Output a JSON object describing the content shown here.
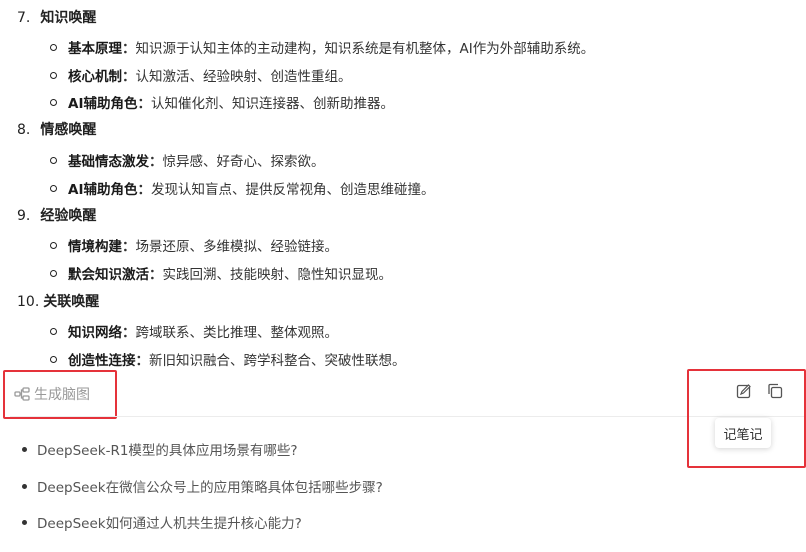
{
  "sections": [
    {
      "number": "7.",
      "title": "知识唤醒",
      "items": [
        {
          "label": "基本原理",
          "text": "知识源于认知主体的主动建构，知识系统是有机整体，AI作为外部辅助系统。"
        },
        {
          "label": "核心机制",
          "text": "认知激活、经验映射、创造性重组。"
        },
        {
          "label": "AI辅助角色",
          "text": "认知催化剂、知识连接器、创新助推器。"
        }
      ]
    },
    {
      "number": "8.",
      "title": "情感唤醒",
      "items": [
        {
          "label": "基础情态激发",
          "text": "惊异感、好奇心、探索欲。"
        },
        {
          "label": "AI辅助角色",
          "text": "发现认知盲点、提供反常视角、创造思维碰撞。"
        }
      ]
    },
    {
      "number": "9.",
      "title": "经验唤醒",
      "items": [
        {
          "label": "情境构建",
          "text": "场景还原、多维模拟、经验链接。"
        },
        {
          "label": "默会知识激活",
          "text": "实践回溯、技能映射、隐性知识显现。"
        }
      ]
    },
    {
      "number": "10.",
      "title": "关联唤醒",
      "items": [
        {
          "label": "知识网络",
          "text": "跨域联系、类比推理、整体观照。"
        },
        {
          "label": "创造性连接",
          "text": "新旧知识融合、跨学科整合、突破性联想。"
        }
      ]
    }
  ],
  "actions": {
    "mindmap_label": "生成脑图",
    "mindmap_icon": "mindmap-icon",
    "note_icon": "edit-note-icon",
    "copy_icon": "copy-icon",
    "note_tooltip": "记笔记"
  },
  "related_questions": [
    "DeepSeek-R1模型的具体应用场景有哪些?",
    "DeepSeek在微信公众号上的应用策略具体包括哪些步骤?",
    "DeepSeek如何通过人机共生提升核心能力?"
  ],
  "colors": {
    "highlight_box": "#e5323a",
    "muted_text": "#999999"
  }
}
